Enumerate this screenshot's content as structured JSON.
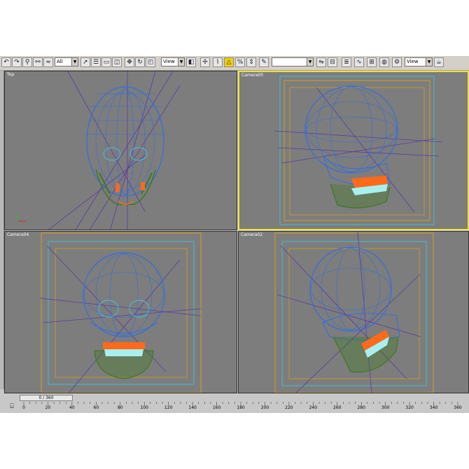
{
  "toolbar": {
    "selection_filter": "All",
    "ref_coord_system": "View",
    "named_selection": "",
    "render_type": "View",
    "icons": [
      "undo-icon",
      "redo-icon",
      "link-icon",
      "unlink-icon",
      "bind-space-warp-icon",
      "selection-filter",
      "select-object-icon",
      "select-by-name-icon",
      "region-select-icon",
      "window-crossing-icon",
      "select-move-icon",
      "select-rotate-icon",
      "select-scale-icon",
      "reference-coordinate-system",
      "pivot-center-icon",
      "manipulate-icon",
      "snap-toggle-icon",
      "angle-snap-icon",
      "percent-snap-icon",
      "spinner-snap-icon",
      "named-selection-set",
      "mirror-icon",
      "align-icon",
      "layer-manager-icon",
      "curve-editor-icon",
      "schematic-view-icon",
      "material-editor-icon",
      "render-setup-icon",
      "render-type",
      "quick-render-icon"
    ]
  },
  "viewports": {
    "top_left": {
      "label": "Top"
    },
    "top_right": {
      "label": "Camera05"
    },
    "bottom_left": {
      "label": "Camera04"
    },
    "bottom_right": {
      "label": "Camera02"
    }
  },
  "timeline": {
    "frame_display": "0 / 360",
    "ticks": [
      "0",
      "20",
      "40",
      "60",
      "80",
      "100",
      "120",
      "140",
      "160",
      "180",
      "200",
      "220",
      "240",
      "260",
      "280",
      "300",
      "320",
      "340",
      "360"
    ]
  },
  "colors": {
    "viewport_bg": "#7d7d7d",
    "active_border": "#f2e13a",
    "skull_wire": "#2e6fe0",
    "cyan_wire": "#3ec8e0",
    "jaw_wire": "#3c7a1e",
    "teeth_orange": "#ff6a1a",
    "teeth_cyan": "#a8f0f0",
    "camera_lines": "#5a3aa0",
    "safe_frame_orange": "#d2a020",
    "safe_frame_cyan": "#40c0d0"
  }
}
